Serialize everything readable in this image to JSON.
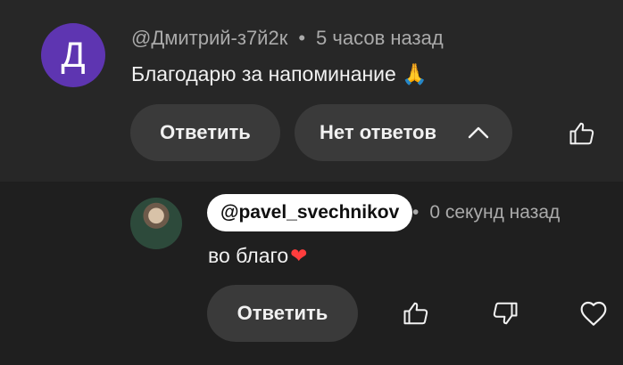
{
  "comment": {
    "avatar_letter": "Д",
    "author": "@Дмитрий-з7й2к",
    "separator": "•",
    "time": "5 часов назад",
    "text": "Благодарю за напоминание",
    "emoji": "🙏",
    "reply_label": "Ответить",
    "replies_label": "Нет ответов",
    "avatar_color": "#5e35b1"
  },
  "reply": {
    "mention": "@pavel_svechnikov",
    "separator": "•",
    "time": "0 секунд назад",
    "text": "во благо",
    "emoji": "❤",
    "reply_label": "Ответить"
  },
  "icons": {
    "like": "thumbs-up-icon",
    "dislike": "thumbs-down-icon",
    "chevron": "chevron-up-icon",
    "heart": "heart-outline-icon"
  }
}
